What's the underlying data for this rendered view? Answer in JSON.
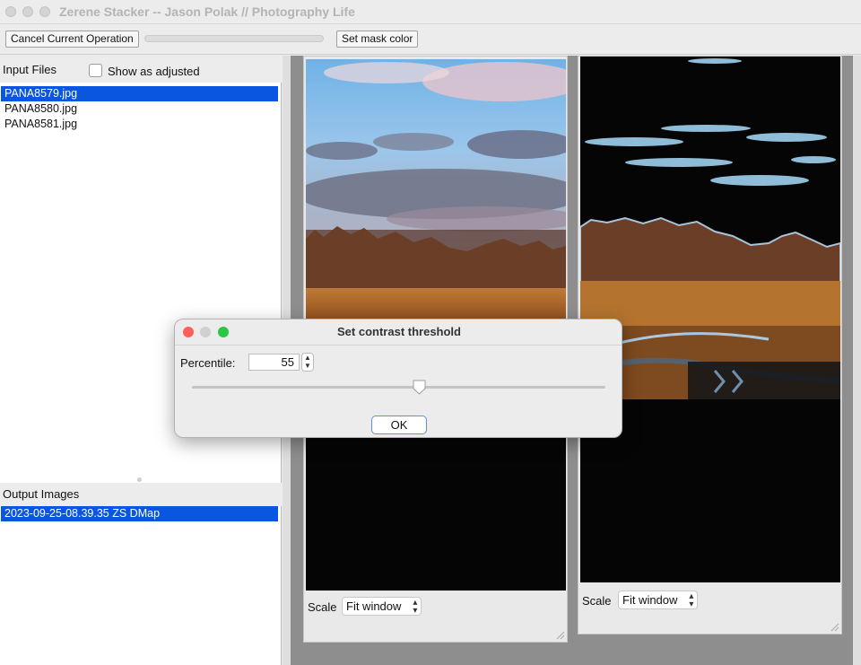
{
  "window": {
    "title": "Zerene Stacker -- Jason Polak // Photography Life"
  },
  "toolbar": {
    "cancel_label": "Cancel Current Operation",
    "progress": 0,
    "mask_color_label": "Set mask color"
  },
  "input_files": {
    "header": "Input Files",
    "show_adjusted_label": "Show as adjusted",
    "show_adjusted_checked": false,
    "items": [
      {
        "name": "PANA8579.jpg",
        "selected": true
      },
      {
        "name": "PANA8580.jpg",
        "selected": false
      },
      {
        "name": "PANA8581.jpg",
        "selected": false
      }
    ]
  },
  "output_images": {
    "header": "Output Images",
    "items": [
      {
        "name": "2023-09-25-08.39.35 ZS DMap",
        "selected": true
      }
    ]
  },
  "left_preview": {
    "scale_label": "Scale",
    "scale_value": "Fit window"
  },
  "right_preview": {
    "scale_label": "Scale",
    "scale_value": "Fit window"
  },
  "dialog": {
    "title": "Set contrast threshold",
    "percentile_label": "Percentile:",
    "percentile_value": "55",
    "slider_value": 55,
    "slider_max": 100,
    "ok_label": "OK"
  },
  "colors": {
    "selection": "#0a56e0",
    "traffic_red": "#ff5f57",
    "traffic_yellow_inactive": "#d0d0d0",
    "traffic_green": "#28c840",
    "default_button_border": "#5e8fd8"
  }
}
